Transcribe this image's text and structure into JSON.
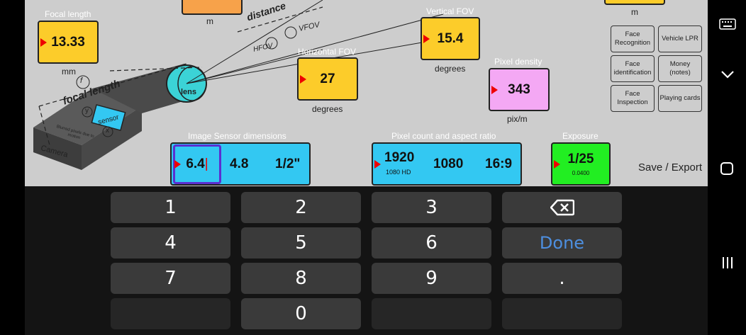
{
  "diagram": {
    "labels": {
      "distance": "distance",
      "vfov": "VFOV",
      "hfov": "HFOV",
      "focal_length": "focal length",
      "lens": "lens",
      "sensor": "sensor",
      "camera": "Camera",
      "blurred": "Blurred pixels due to motion",
      "f": "f",
      "x": "x",
      "y": "y",
      "top_unit_left": "m",
      "top_unit_right": "m"
    }
  },
  "focal_length": {
    "label": "Focal length",
    "value": "13.33",
    "unit": "mm"
  },
  "vertical_fov": {
    "label": "Vertical FOV",
    "value": "15.4",
    "unit": "degrees"
  },
  "horizontal_fov": {
    "label": "Horizontal FOV",
    "value": "27",
    "unit": "degrees"
  },
  "pixel_density": {
    "label": "Pixel density",
    "value": "343",
    "unit": "pix/m"
  },
  "presets": [
    {
      "label": "Face Recognition"
    },
    {
      "label": "Vehicle LPR"
    },
    {
      "label": "Face identification"
    },
    {
      "label": "Money (notes)"
    },
    {
      "label": "Face Inspection"
    },
    {
      "label": "Playing cards"
    }
  ],
  "sensor": {
    "label": "Image Sensor dimensions",
    "width": "6.4",
    "height": "4.8",
    "format": "1/2\""
  },
  "pixels": {
    "label": "Pixel count and aspect ratio",
    "h": "1920",
    "h_sub": "1080 HD",
    "v": "1080",
    "aspect": "16:9"
  },
  "exposure": {
    "label": "Exposure",
    "value": "1/25",
    "sub": "0.0400"
  },
  "save_export": "Save / Export",
  "keyboard": {
    "keys": [
      "1",
      "2",
      "3",
      "4",
      "5",
      "6",
      "7",
      "8",
      "9",
      "0",
      ".",
      ""
    ],
    "done": "Done"
  },
  "colors": {
    "yellow": "#fccc2a",
    "pink": "#f4a8f4",
    "green": "#22ee22",
    "cyan": "#33c8f2",
    "orange": "#f7a24a",
    "done_blue": "#4d8fe0"
  },
  "icons": [
    "keyboard-icon",
    "chevron-down-icon",
    "home-icon",
    "recents-icon",
    "backspace-icon"
  ]
}
